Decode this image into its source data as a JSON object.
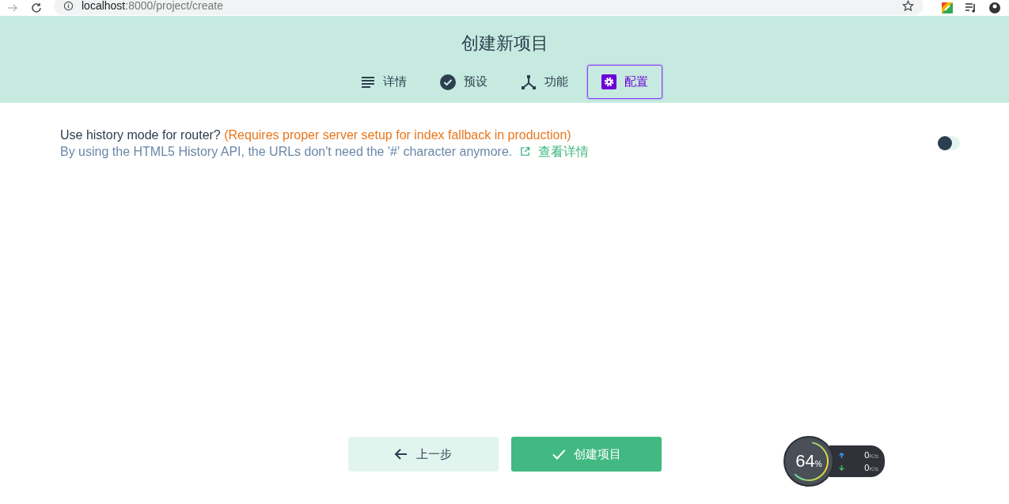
{
  "browser": {
    "url_host": "localhost",
    "url_rest": ":8000/project/create"
  },
  "header": {
    "title": "创建新项目"
  },
  "tabs": [
    {
      "label": "详情",
      "kind": "list",
      "selected": false
    },
    {
      "label": "预设",
      "kind": "check",
      "selected": false
    },
    {
      "label": "功能",
      "kind": "fork",
      "selected": false
    },
    {
      "label": "配置",
      "kind": "gear",
      "selected": true
    }
  ],
  "settings": [
    {
      "kind": "switch",
      "label": "Use history mode for router?",
      "note": "(Requires proper server setup for index fallback in production)",
      "description": "By using the HTML5 History API, the URLs don't need the '#' character anymore.",
      "link": "查看详情",
      "on": false
    }
  ],
  "buttons": [
    {
      "kind": "back",
      "label": "上一步"
    },
    {
      "kind": "primary",
      "label": "创建项目"
    }
  ],
  "speed_widget": {
    "percent": "64",
    "percent_unit": "%",
    "upload": "0",
    "upload_unit": "K/s",
    "download": "0",
    "download_unit": "K/s"
  }
}
